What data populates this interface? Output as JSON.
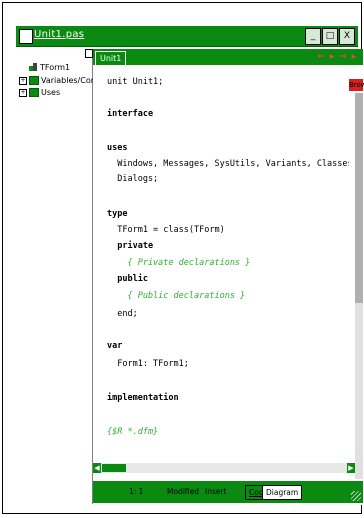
{
  "window": {
    "title": "Unit1.pas",
    "buttons": [
      "_",
      "□",
      "X"
    ]
  },
  "tree": {
    "root_label": "TForm1",
    "items": [
      {
        "label": "Variables/Constants",
        "expander": "+"
      },
      {
        "label": "Uses",
        "expander": "+"
      }
    ]
  },
  "editor": {
    "tab_label": "Unit1",
    "nav_arrows": "⇐ ▸ ⇒ ▸",
    "browse_label": "Brow",
    "code_lines": [
      {
        "text": "unit Unit1;",
        "kind": "plain"
      },
      {
        "text": "interface",
        "kind": "keyword"
      },
      {
        "text": "uses",
        "kind": "keyword"
      },
      {
        "text": "  Windows, Messages, SysUtils, Variants, Classes, Graphics, Co",
        "kind": "plain"
      },
      {
        "text": "  Dialogs;",
        "kind": "plain"
      },
      {
        "text": "type",
        "kind": "keyword"
      },
      {
        "text": "  TForm1 = class(TForm)",
        "kind": "plain"
      },
      {
        "text": "  private",
        "kind": "keyword"
      },
      {
        "text": "    { Private declarations }",
        "kind": "comment"
      },
      {
        "text": "  public",
        "kind": "keyword"
      },
      {
        "text": "    { Public declarations }",
        "kind": "comment"
      },
      {
        "text": "  end;",
        "kind": "plain"
      },
      {
        "text": "var",
        "kind": "keyword"
      },
      {
        "text": "  Form1: TForm1;",
        "kind": "plain"
      },
      {
        "text": "implementation",
        "kind": "keyword"
      },
      {
        "text": "{$R *.dfm}",
        "kind": "comment"
      }
    ]
  },
  "statusbar": {
    "cursor_position": "1:  1",
    "modified_label": "Modified",
    "insert_label": "Insert",
    "tabs": [
      "Code",
      "Diagram"
    ],
    "active_tab": "Diagram"
  },
  "colors": {
    "accent": "#0a8a10",
    "comment": "#30b030",
    "nav_arrow": "#ff4040"
  }
}
